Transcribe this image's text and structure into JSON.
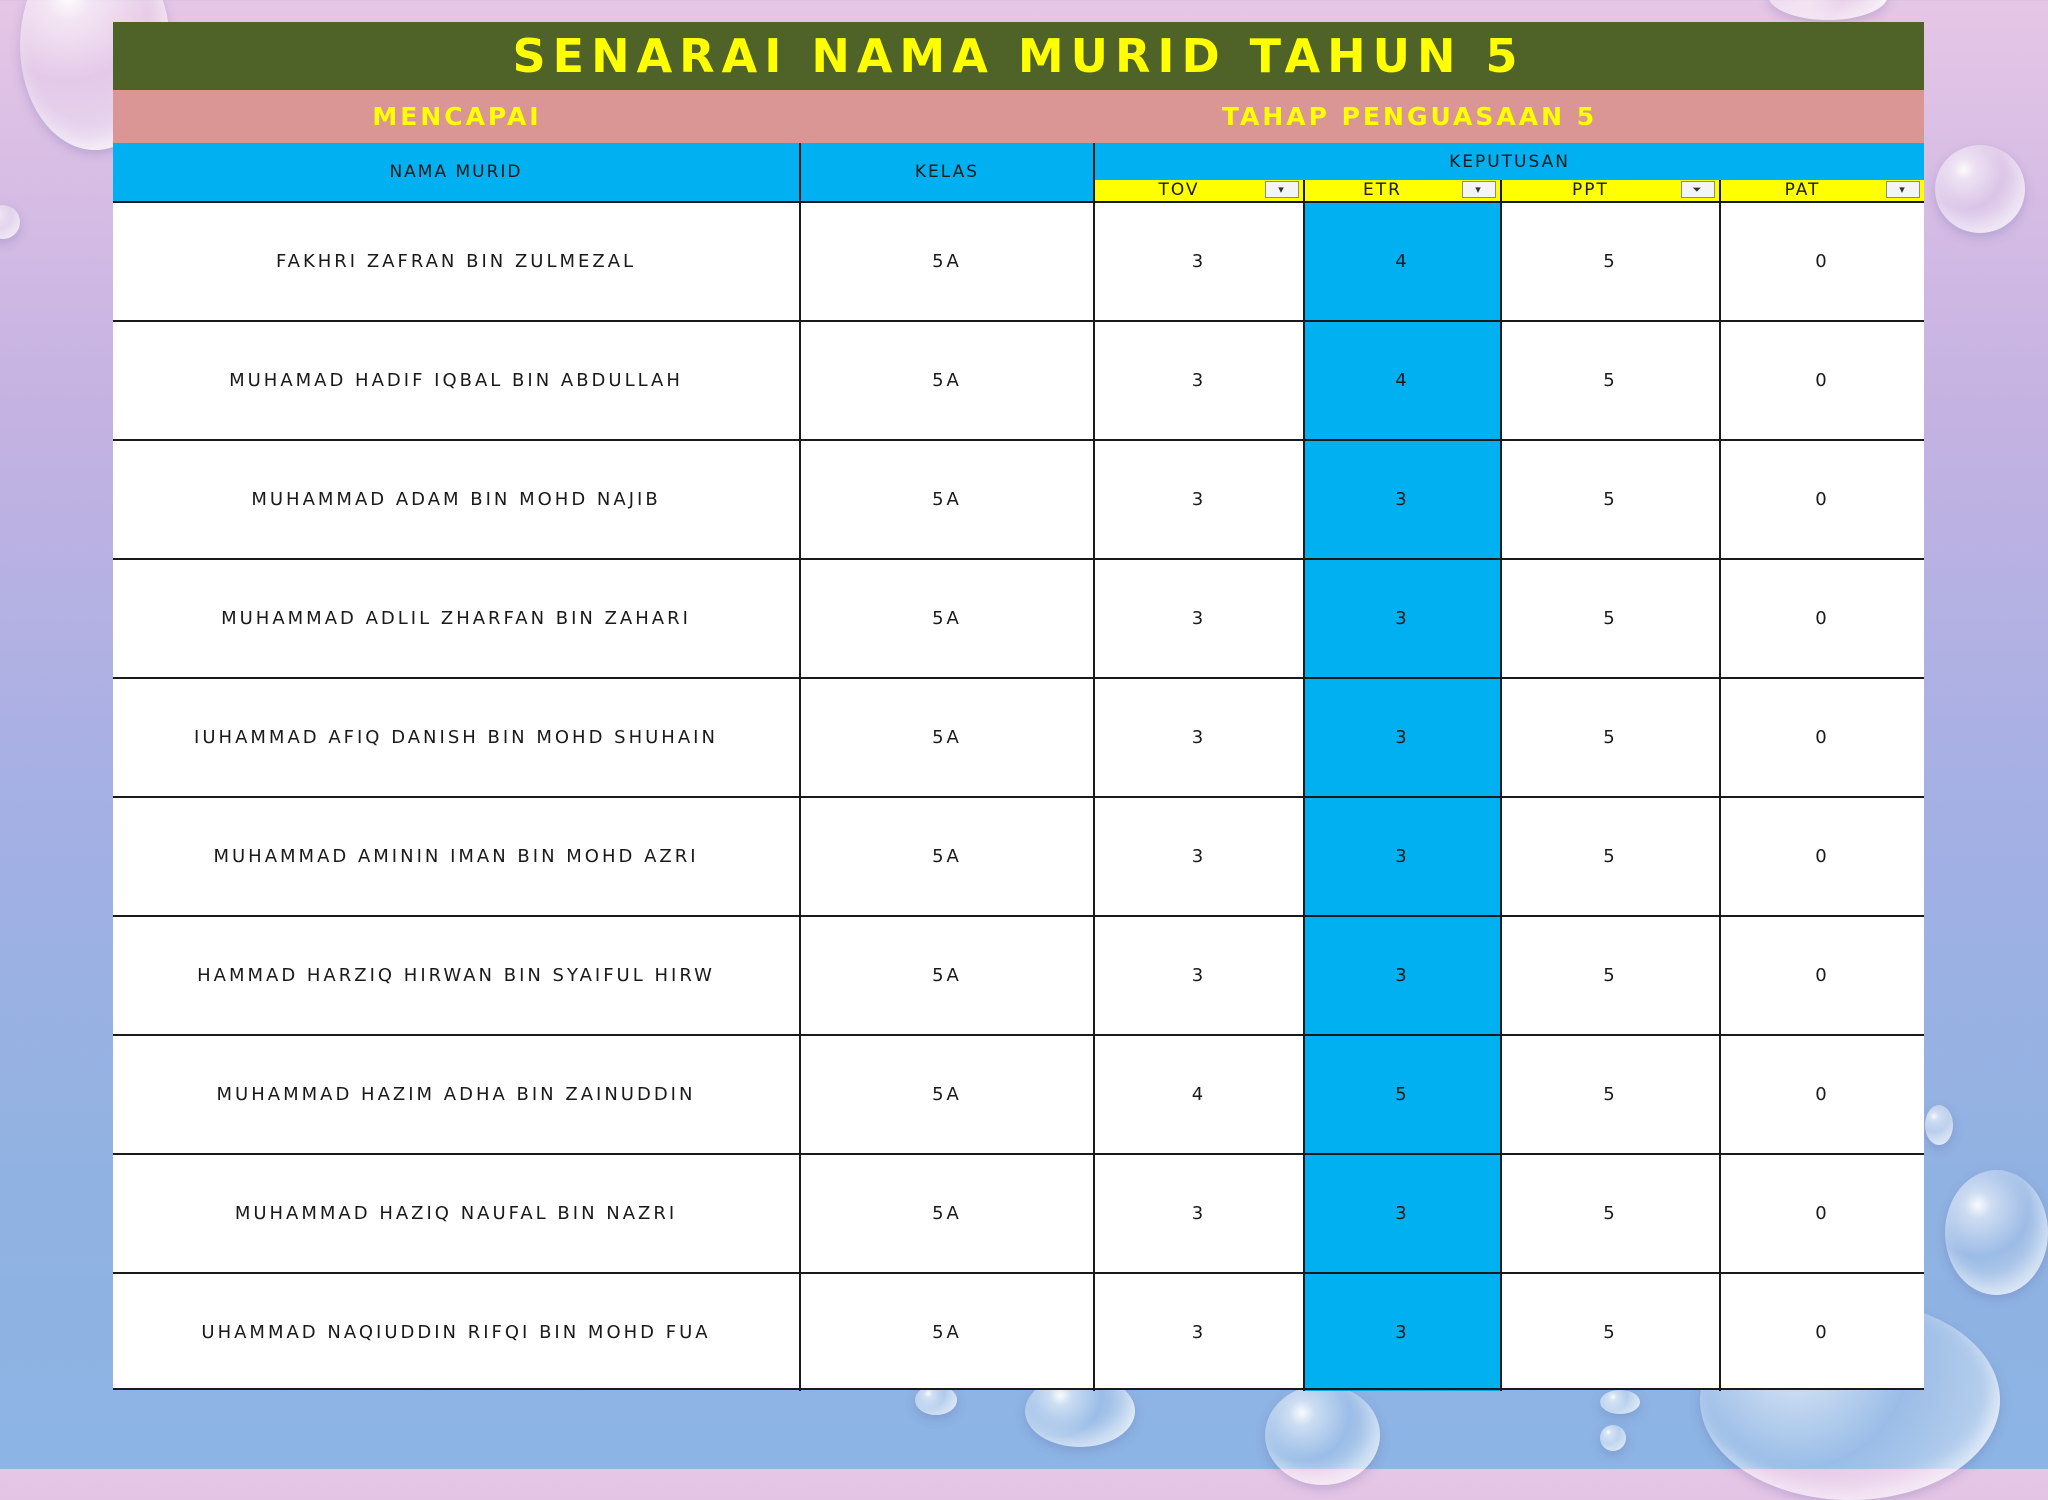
{
  "title": "SENARAI NAMA MURID TAHUN 5",
  "subtitle_left": "MENCAPAI",
  "subtitle_right": "TAHAP PENGUASAAN 5",
  "headers": {
    "nama": "NAMA MURID",
    "kelas": "KELAS",
    "keputusan": "KEPUTUSAN",
    "tov": "TOV",
    "etr": "ETR",
    "ppt": "PPT",
    "pat": "PAT"
  },
  "filter_icons": {
    "tov": "dropdown-arrow-icon",
    "etr": "dropdown-arrow-icon",
    "ppt": "filter-icon",
    "pat": "dropdown-arrow-icon"
  },
  "filter_glyphs": {
    "dropdown": "▾",
    "filter": "⏷"
  },
  "colors": {
    "title_bg": "#4f6228",
    "title_text": "#ffff00",
    "subtitle_bg": "#da9694",
    "header_bg": "#00b0f0",
    "subheader_bg": "#ffff00",
    "etr_column_bg": "#00b0f0"
  },
  "rows": [
    {
      "nama": "FAKHRI ZAFRAN BIN ZULMEZAL",
      "kelas": "5A",
      "tov": "3",
      "etr": "4",
      "ppt": "5",
      "pat": "0"
    },
    {
      "nama": "MUHAMAD HADIF IQBAL BIN ABDULLAH",
      "kelas": "5A",
      "tov": "3",
      "etr": "4",
      "ppt": "5",
      "pat": "0"
    },
    {
      "nama": "MUHAMMAD ADAM BIN MOHD NAJIB",
      "kelas": "5A",
      "tov": "3",
      "etr": "3",
      "ppt": "5",
      "pat": "0"
    },
    {
      "nama": "MUHAMMAD ADLIL ZHARFAN BIN ZAHARI",
      "kelas": "5A",
      "tov": "3",
      "etr": "3",
      "ppt": "5",
      "pat": "0"
    },
    {
      "nama": "IUHAMMAD AFIQ DANISH BIN MOHD SHUHAIN",
      "kelas": "5A",
      "tov": "3",
      "etr": "3",
      "ppt": "5",
      "pat": "0"
    },
    {
      "nama": "MUHAMMAD AMININ IMAN BIN MOHD AZRI",
      "kelas": "5A",
      "tov": "3",
      "etr": "3",
      "ppt": "5",
      "pat": "0"
    },
    {
      "nama": "HAMMAD HARZIQ HIRWAN BIN SYAIFUL HIRW",
      "kelas": "5A",
      "tov": "3",
      "etr": "3",
      "ppt": "5",
      "pat": "0"
    },
    {
      "nama": "MUHAMMAD HAZIM ADHA BIN ZAINUDDIN",
      "kelas": "5A",
      "tov": "4",
      "etr": "5",
      "ppt": "5",
      "pat": "0"
    },
    {
      "nama": "MUHAMMAD HAZIQ NAUFAL BIN NAZRI",
      "kelas": "5A",
      "tov": "3",
      "etr": "3",
      "ppt": "5",
      "pat": "0"
    },
    {
      "nama": "UHAMMAD NAQIUDDIN RIFQI BIN MOHD FUA",
      "kelas": "5A",
      "tov": "3",
      "etr": "3",
      "ppt": "5",
      "pat": "0"
    }
  ]
}
